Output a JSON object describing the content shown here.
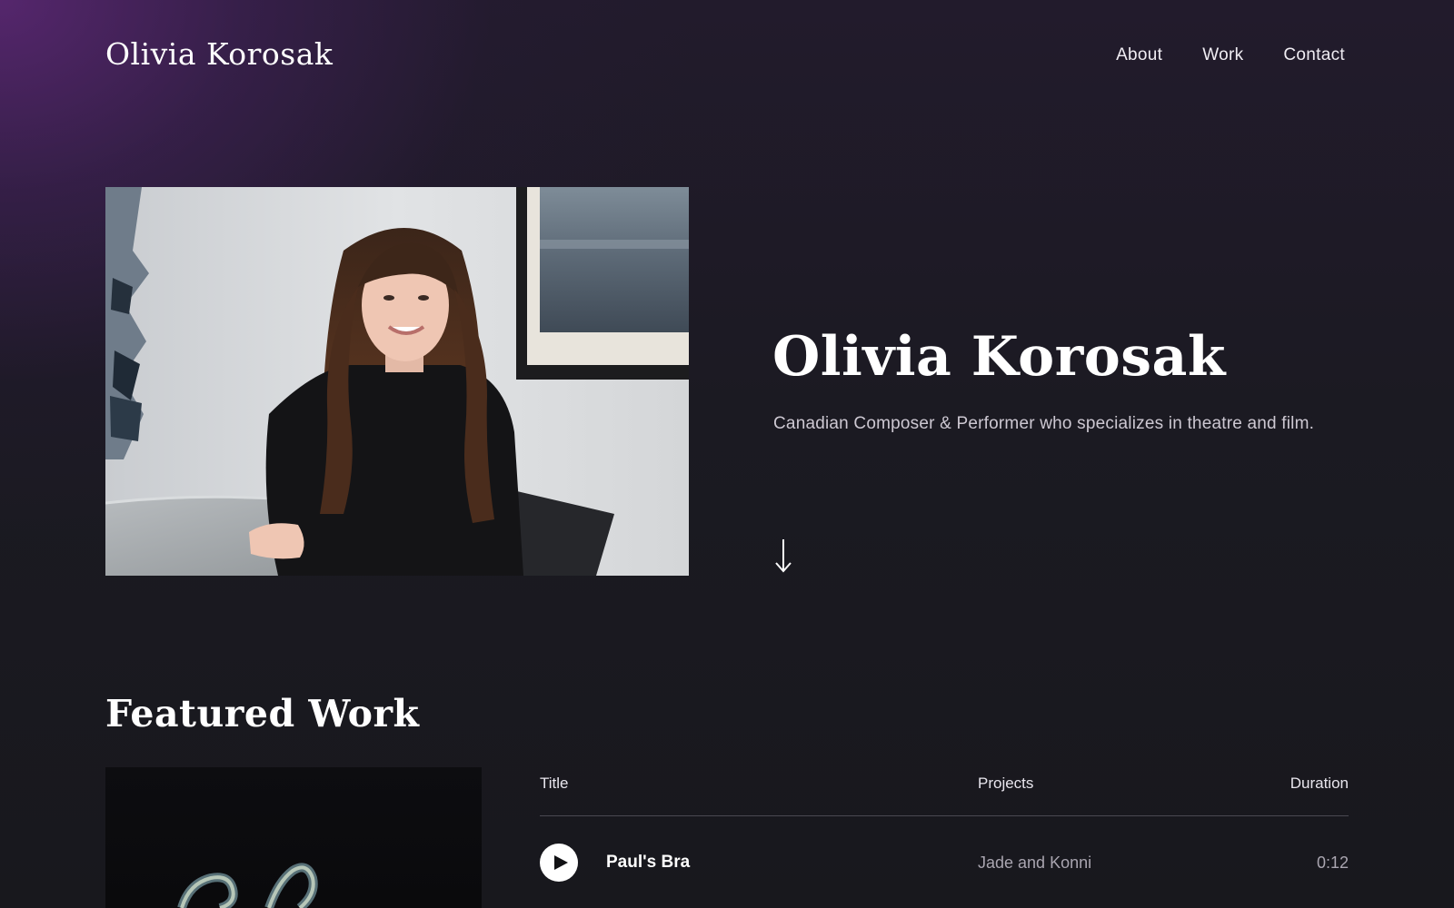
{
  "header": {
    "brand": "Olivia Korosak",
    "nav": [
      {
        "label": "About"
      },
      {
        "label": "Work"
      },
      {
        "label": "Contact"
      }
    ]
  },
  "hero": {
    "title": "Olivia Korosak",
    "subtitle": "Canadian Composer & Performer who specializes in theatre and film.",
    "scroll_icon": "arrow-down-icon"
  },
  "featured": {
    "title": "Featured Work",
    "table": {
      "columns": {
        "title": "Title",
        "projects": "Projects",
        "duration": "Duration"
      },
      "rows": [
        {
          "title": "Paul's Bra",
          "project": "Jade and Konni",
          "duration": "0:12",
          "icon": "play-icon"
        }
      ]
    }
  },
  "colors": {
    "accent_purple": "#5e2878",
    "background": "#18181d",
    "text": "#ffffff",
    "muted_text": "#a9a5b0"
  }
}
